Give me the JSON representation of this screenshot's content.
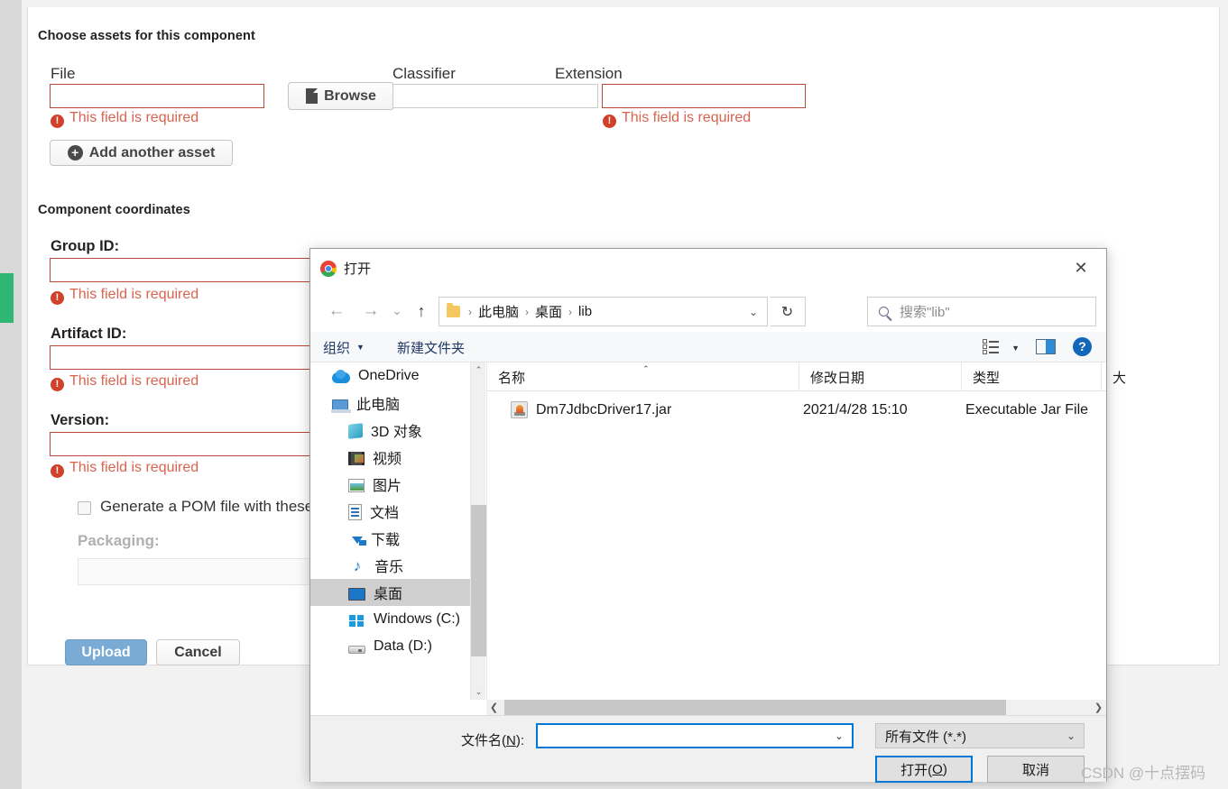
{
  "upload_form": {
    "assets_section_title": "Choose assets for this component",
    "columns": {
      "file": "File",
      "classifier": "Classifier",
      "extension": "Extension"
    },
    "file_value": "",
    "classifier_value": "",
    "extension_value": "",
    "browse_label": "Browse",
    "add_asset_label": "Add another asset",
    "error_text": "This field is required",
    "coordinates_section_title": "Component coordinates",
    "group_id_label": "Group ID:",
    "group_id_value": "",
    "artifact_id_label": "Artifact ID:",
    "artifact_id_value": "",
    "version_label": "Version:",
    "version_value": "",
    "generate_pom_label": "Generate a POM file with these",
    "packaging_label": "Packaging:",
    "packaging_value": "",
    "upload_label": "Upload",
    "cancel_label": "Cancel",
    "accent_color": "#7aabd4",
    "error_color": "#d9634f"
  },
  "file_dialog": {
    "title": "打开",
    "close_label": "✕",
    "nav": {
      "back": "←",
      "forward": "→",
      "recent": "⌄",
      "up": "↑"
    },
    "breadcrumbs": [
      "此电脑",
      "桌面",
      "lib"
    ],
    "breadcrumb_separator": "›",
    "address_caret": "⌄",
    "refresh_label": "↻",
    "search_placeholder": "搜索\"lib\"",
    "commands": {
      "organize": "组织",
      "organize_caret": "▼",
      "new_folder": "新建文件夹",
      "help": "?"
    },
    "sidebar": [
      {
        "label": "OneDrive",
        "icon": "onedrive-icon",
        "indent": false,
        "selected": false
      },
      {
        "label": "此电脑",
        "icon": "this-pc-icon",
        "indent": false,
        "selected": false
      },
      {
        "label": "3D 对象",
        "icon": "3d-objects-icon",
        "indent": true,
        "selected": false
      },
      {
        "label": "视频",
        "icon": "videos-icon",
        "indent": true,
        "selected": false
      },
      {
        "label": "图片",
        "icon": "pictures-icon",
        "indent": true,
        "selected": false
      },
      {
        "label": "文档",
        "icon": "documents-icon",
        "indent": true,
        "selected": false
      },
      {
        "label": "下载",
        "icon": "downloads-icon",
        "indent": true,
        "selected": false
      },
      {
        "label": "音乐",
        "icon": "music-icon",
        "indent": true,
        "selected": false
      },
      {
        "label": "桌面",
        "icon": "desktop-icon",
        "indent": true,
        "selected": true
      },
      {
        "label": "Windows (C:)",
        "icon": "windows-drive-icon",
        "indent": true,
        "selected": false
      },
      {
        "label": "Data (D:)",
        "icon": "drive-icon",
        "indent": true,
        "selected": false
      }
    ],
    "columns": [
      {
        "label": "名称"
      },
      {
        "label": "修改日期"
      },
      {
        "label": "类型"
      },
      {
        "label": "大"
      }
    ],
    "sort_indicator": "⌃",
    "files": [
      {
        "name": "Dm7JdbcDriver17.jar",
        "modified": "2021/4/28 15:10",
        "type": "Executable Jar File",
        "icon": "jar-file-icon"
      }
    ],
    "footer": {
      "filename_label_prefix": "文件名(",
      "filename_label_key": "N",
      "filename_label_suffix": "):",
      "filename_value": "",
      "filename_caret": "⌄",
      "filter_value": "所有文件 (*.*)",
      "filter_caret": "⌄",
      "open_prefix": "打开(",
      "open_key": "O",
      "open_suffix": ")",
      "cancel_label": "取消"
    },
    "scroll_arrows": {
      "up": "⌃",
      "down": "⌄",
      "left": "❮",
      "right": "❯"
    }
  },
  "watermark": "CSDN @十点摆码"
}
